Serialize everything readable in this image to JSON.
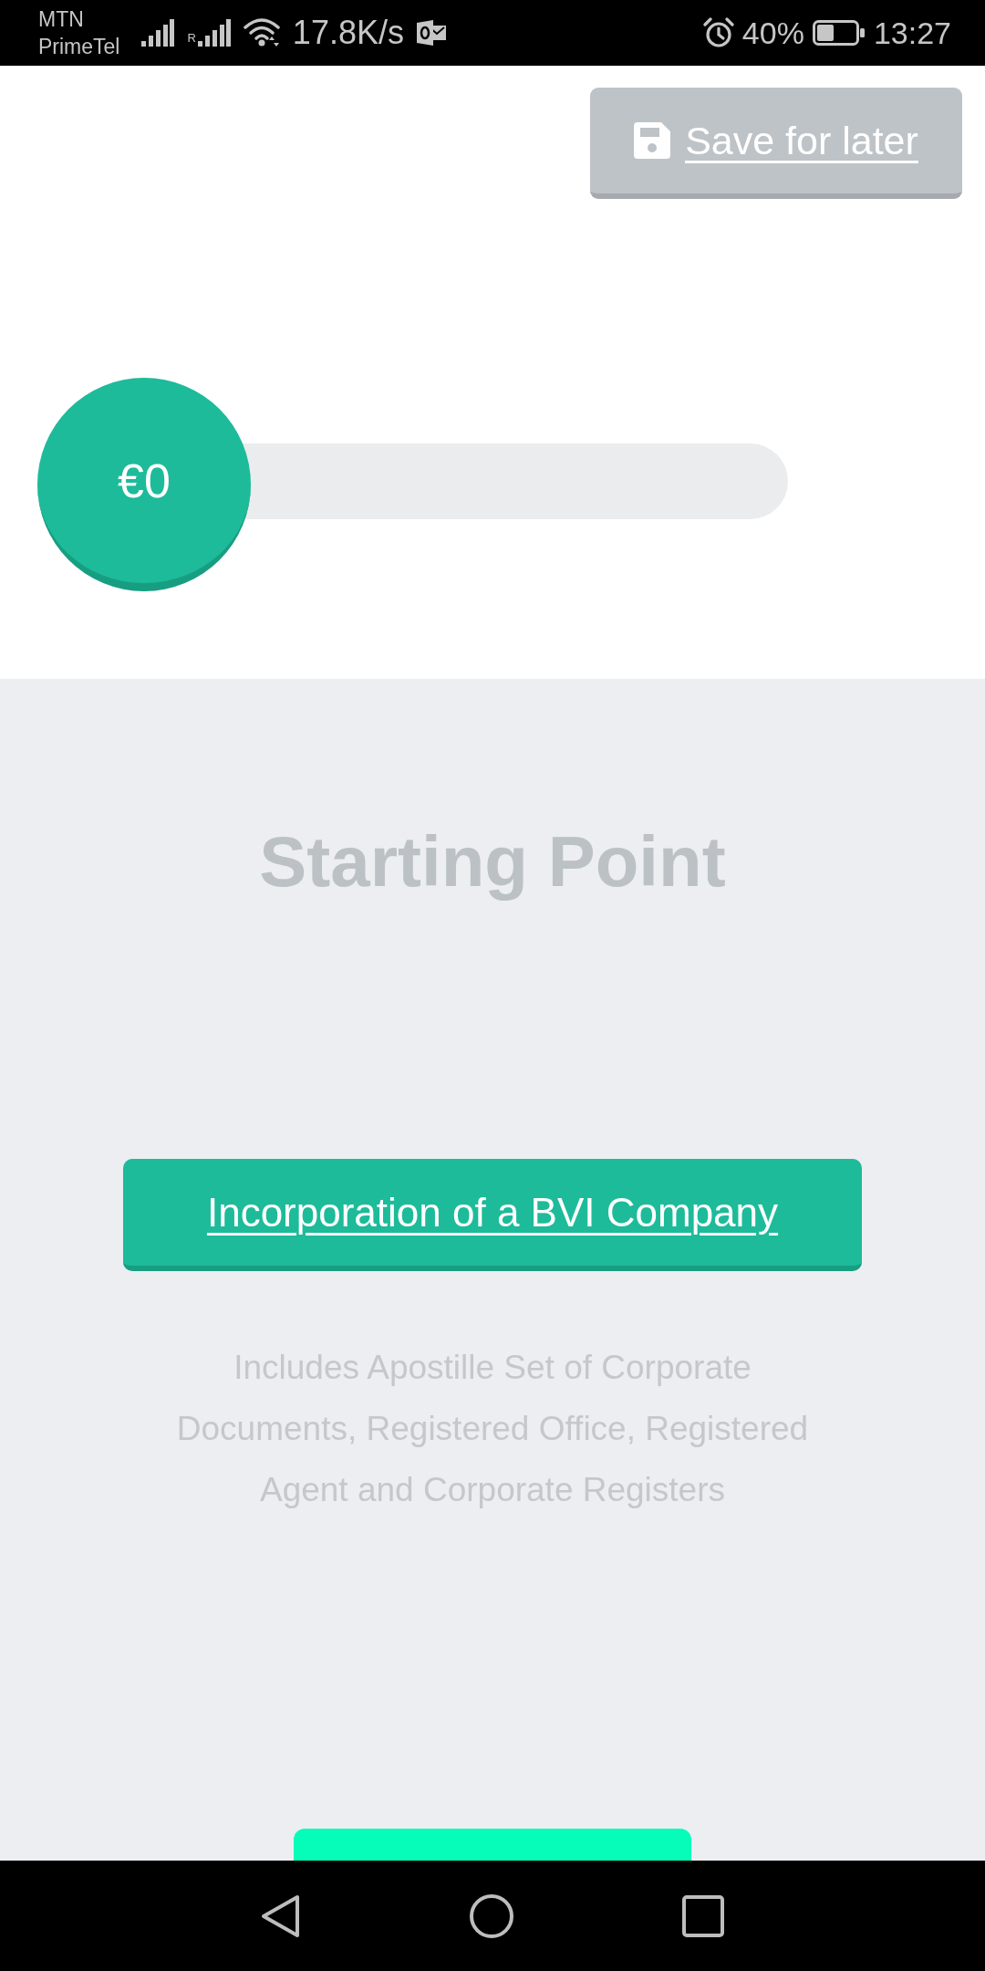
{
  "status_bar": {
    "carrier_lines": [
      "MTN",
      "PrimeTel"
    ],
    "roaming_mark": "R",
    "network_speed": "17.8K/s",
    "battery_percent": "40%",
    "time": "13:27"
  },
  "save_button": {
    "label": "Save for later"
  },
  "progress": {
    "level": 0,
    "reading": "€0"
  },
  "section": {
    "title": "Starting Point",
    "package_button": {
      "label": "Incorporation of a BVI Company"
    },
    "description": "Includes Apostille Set of Corporate Documents, Registered Office, Registered Agent and Corporate Registers"
  }
}
